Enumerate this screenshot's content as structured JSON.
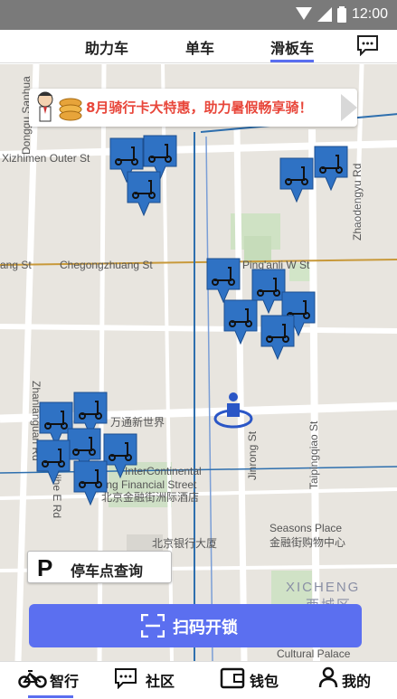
{
  "status_bar": {
    "time": "12:00"
  },
  "tabs": [
    {
      "label": "助力车"
    },
    {
      "label": "单车"
    },
    {
      "label": "滑板车",
      "active": true
    }
  ],
  "promo": {
    "text": "8月骑行卡大特惠，助力暑假畅享骑！"
  },
  "map": {
    "roads": [
      "Xizhimen Outer St",
      "Donggu Sanhua",
      "Zhaodengyu Rd",
      "ang St",
      "Chegongzhuang St",
      "Ping'anli W St",
      "Zhanlanguan Rd",
      "Jinrong St",
      "Taipingqiao St",
      "anlihe E Rd"
    ],
    "pois": [
      "万通新世界",
      "InterContinental",
      "jing Financial Street",
      "北京金融街洲际酒店",
      "北京银行大厦",
      "Seasons Place",
      "金融街购物中心",
      "Cultural Palace"
    ],
    "district_en": "XICHENG",
    "district_zh": "西城区"
  },
  "parking_button": {
    "icon_letter": "P",
    "label": "停车点查询"
  },
  "scan_button": {
    "label": "扫码开锁"
  },
  "bottom_nav": [
    {
      "label": "智行",
      "icon": "bike-icon",
      "active": true
    },
    {
      "label": "社区",
      "icon": "chat-icon"
    },
    {
      "label": "钱包",
      "icon": "wallet-icon"
    },
    {
      "label": "我的",
      "icon": "person-icon"
    }
  ],
  "colors": {
    "accent": "#5b6ff0",
    "pin": "#2f72c4",
    "promo_text": "#e8463a"
  }
}
